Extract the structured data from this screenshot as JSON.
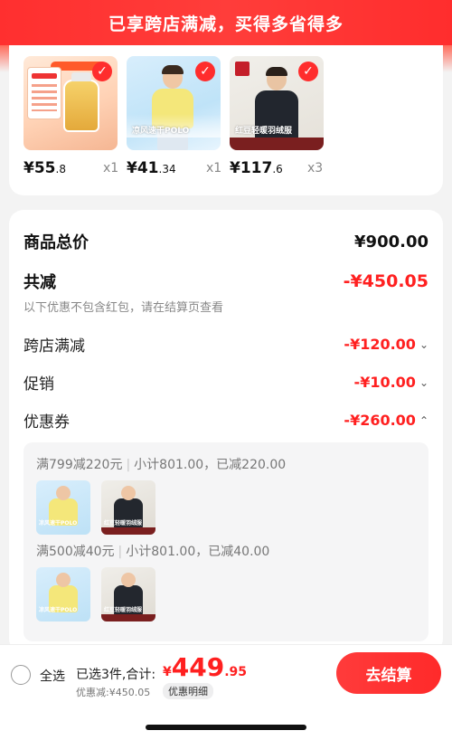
{
  "banner": {
    "text": "已享跨店满减，买得多省得多"
  },
  "colors": {
    "accent": "#ff2020",
    "banner": "#ff2f2f"
  },
  "products": [
    {
      "name": "supplement",
      "overlay": "",
      "price_main": "¥55",
      "price_dec": ".8",
      "qty": "x1"
    },
    {
      "name": "yellow-polo",
      "overlay": "凉风速干POLO",
      "price_main": "¥41",
      "price_dec": ".34",
      "qty": "x1"
    },
    {
      "name": "down-jacket",
      "overlay": "红豆轻暖羽绒服",
      "price_main": "¥117",
      "price_dec": ".6",
      "qty": "x3"
    }
  ],
  "summary": {
    "total_label": "商品总价",
    "total_value": "¥900.00",
    "reduce_label": "共减",
    "reduce_value": "-¥450.05",
    "note": "以下优惠不包含红包，请在结算页查看",
    "cross_store_label": "跨店满减",
    "cross_store_value": "-¥120.00",
    "promo_label": "促销",
    "promo_value": "-¥10.00",
    "coupon_label": "优惠券",
    "coupon_value": "-¥260.00"
  },
  "coupons": [
    {
      "rule": "满799减220元",
      "detail": "小计801.00，已减220.00"
    },
    {
      "rule": "满500减40元",
      "detail": "小计801.00，已减40.00"
    }
  ],
  "thumb_text": {
    "polo": "凉风速干POLO",
    "jacket": "红豆轻暖羽绒服"
  },
  "bottom": {
    "select_all": "全选",
    "selected": "已选3件,合计:",
    "currency": "¥",
    "total_int": "449",
    "total_dec": ".95",
    "discount": "优惠减:¥450.05",
    "detail": "优惠明细",
    "checkout": "去结算"
  },
  "icons": {
    "check": "✓",
    "chevron_down": "⌄",
    "chevron_up": "⌃"
  }
}
